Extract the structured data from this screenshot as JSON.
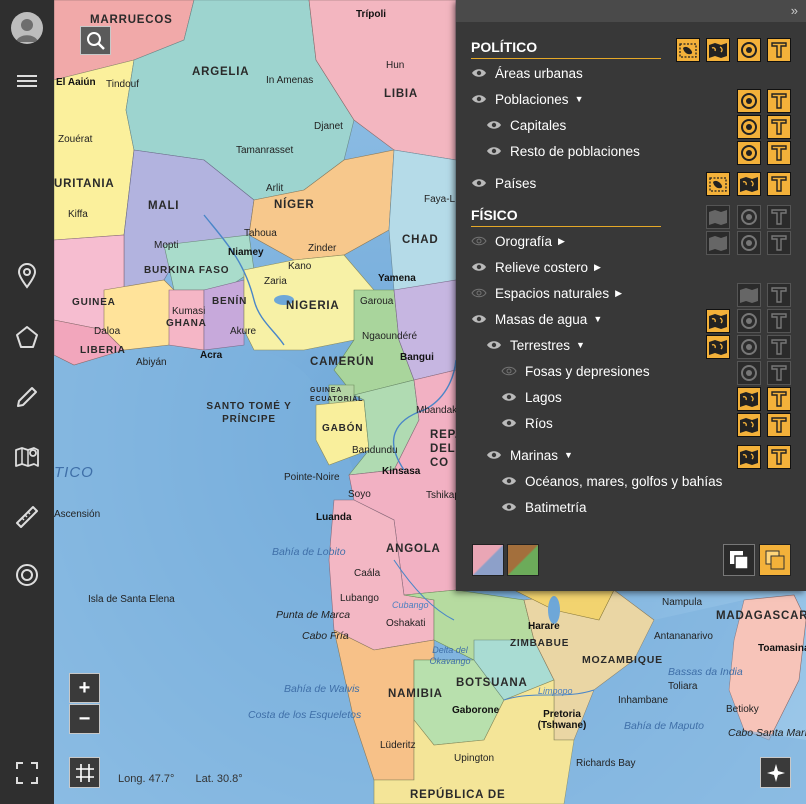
{
  "map": {
    "places": {
      "marruecos": "MARRUECOS",
      "argelia": "ARGELIA",
      "libia": "LIBIA",
      "mauritania": "URITANIA",
      "mali": "MALI",
      "niger": "NÍGER",
      "chad": "CHAD",
      "burkina": "BURKINA FASO",
      "guinea": "GUINEA",
      "ghana": "GHANA",
      "benin": "BENÍN",
      "nigeria": "NIGERIA",
      "liberia": "LIBERIA",
      "camerun": "CAMERÚN",
      "guinea_ec": "GUINEA ECUATORIAL",
      "gabon": "GABÓN",
      "rep_congo": "REP. DEL CO",
      "santo_tome": "SANTO TOMÉ Y PRÍNCIPE",
      "angola": "ANGOLA",
      "zimbabue": "ZIMBABUE",
      "mozambique": "MOZAMBIQUE",
      "namibia": "NAMIBIA",
      "botsuana": "BOTSUANA",
      "madagascar": "MADAGASCAR",
      "rep_sudafrica": "REPÚBLICA DE",
      "tripoli": "Trípoli",
      "hun": "Hun",
      "in_amenas": "In Amenas",
      "tindouf": "Tindouf",
      "laayoune": "El Aaiún",
      "zouerat": "Zouérat",
      "djanet": "Djanet",
      "tamanrasset": "Tamanrasset",
      "arlit": "Arlit",
      "faya": "Faya-L",
      "kiffa": "Kiffa",
      "mopti": "Mopti",
      "tahoua": "Tahoua",
      "niamey": "Niamey",
      "zinder": "Zinder",
      "kano": "Kano",
      "yamena": "Yamena",
      "zaria": "Zaria",
      "daloa": "Daloa",
      "kumasi": "Kumasi",
      "akure": "Akure",
      "garoua": "Garoua",
      "ngaoundere": "Ngaoundéré",
      "abiyan": "Abiyán",
      "acra": "Acra",
      "bangui": "Bangui",
      "mbandaka": "Mbandaka",
      "bandundu": "Bandundu",
      "kinsasa": "Kinsasa",
      "pointe_noire": "Pointe-Noire",
      "soyo": "Soyo",
      "tshikapa": "Tshikapa",
      "luanda": "Luanda",
      "caala": "Caála",
      "lubango": "Lubango",
      "oshakati": "Oshakati",
      "harare": "Harare",
      "nampula": "Nampula",
      "antananarivo": "Antananarivo",
      "toamasina": "Toamasina",
      "gaborone": "Gaborone",
      "pretoria": "Pretoria\n(Tshwane)",
      "inhambane": "Inhambane",
      "toliara": "Toliara",
      "betioky": "Betioky",
      "luderitz": "Lüderitz",
      "upington": "Upington",
      "richards_bay": "Richards Bay",
      "bahia_lobito": "Bahía de Lobito",
      "punta_marca": "Punta de Marca",
      "cabo_fria": "Cabo Fría",
      "bahia_walvis": "Bahía de Walvis",
      "costa_esqueletos": "Costa de los Esqueletos",
      "bahia_maputo": "Bahía de Maputo",
      "cabo_santa_maria": "Cabo Santa María",
      "bassas_india": "Bassas da India",
      "okavango": "Delta del\nOkavango",
      "ascension": "Ascensión",
      "santa_elena": "Isla de Santa Elena",
      "atlantico": "TICO",
      "limpopo": "Limpopo",
      "cubango": "Cubango"
    }
  },
  "toolbar": {
    "icons": [
      "user-icon",
      "menu-icon",
      "location-pin-icon",
      "polygon-icon",
      "pencil-icon",
      "map-pin-icon",
      "ruler-icon",
      "target-icon",
      "fullscreen-icon"
    ]
  },
  "controls": {
    "zoom_in": "+",
    "zoom_out": "−",
    "longitude": "Long. 47.7°",
    "latitude": "Lat. 30.8°"
  },
  "panel": {
    "collapse": "»",
    "politico": {
      "title": "POLÍTICO",
      "areas_urbanas": "Áreas urbanas",
      "poblaciones": "Poblaciones",
      "capitales": "Capitales",
      "resto": "Resto de poblaciones",
      "paises": "Países"
    },
    "fisico": {
      "title": "FÍSICO",
      "orografia": "Orografía",
      "relieve": "Relieve costero",
      "espacios": "Espacios naturales",
      "masas": "Masas de agua",
      "terrestres": "Terrestres",
      "fosas": "Fosas y depresiones",
      "lagos": "Lagos",
      "rios": "Ríos",
      "marinas": "Marinas",
      "oceanos": "Océanos, mares, golfos y bahías",
      "batimetria": "Batimetría"
    },
    "colors": {
      "accent": "#f3b13a",
      "panel_bg": "#383838"
    }
  }
}
